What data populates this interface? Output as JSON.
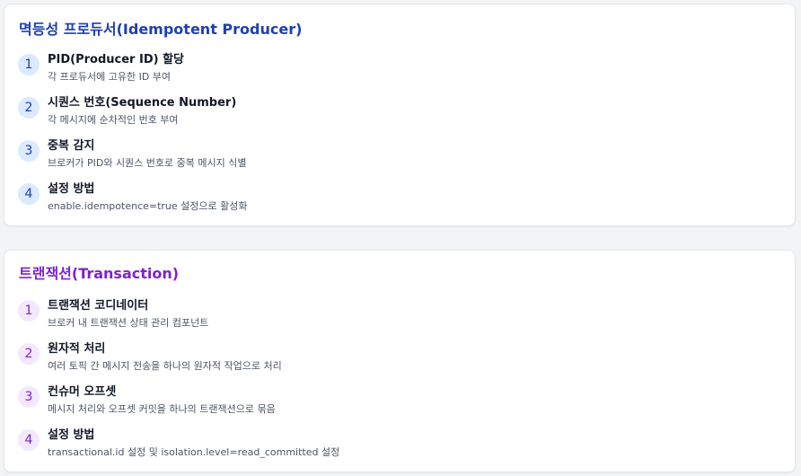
{
  "idempotent": {
    "title": "멱등성 프로듀서(Idempotent Producer)",
    "accent": "#1e40af",
    "steps": [
      {
        "num": "1",
        "title": "PID(Producer ID) 할당",
        "desc": "각 프로듀서에 고유한 ID 부여"
      },
      {
        "num": "2",
        "title": "시퀀스 번호(Sequence Number)",
        "desc": "각 메시지에 순차적인 번호 부여"
      },
      {
        "num": "3",
        "title": "중복 감지",
        "desc": "브로커가 PID와 시퀀스 번호로 중복 메시지 식별"
      },
      {
        "num": "4",
        "title": "설정 방법",
        "desc": "enable.idempotence=true 설정으로 활성화"
      }
    ]
  },
  "transaction": {
    "title": "트랜잭션(Transaction)",
    "accent": "#7e22ce",
    "steps": [
      {
        "num": "1",
        "title": "트랜잭션 코디네이터",
        "desc": "브로커 내 트랜잭션 상태 관리 컴포넌트"
      },
      {
        "num": "2",
        "title": "원자적 처리",
        "desc": "여러 토픽 간 메시지 전송을 하나의 원자적 작업으로 처리"
      },
      {
        "num": "3",
        "title": "컨슈머 오프셋",
        "desc": "메시지 처리와 오프셋 커밋을 하나의 트랜잭션으로 묶음"
      },
      {
        "num": "4",
        "title": "설정 방법",
        "desc": "transactional.id 설정 및 isolation.level=read_committed 설정"
      }
    ]
  }
}
